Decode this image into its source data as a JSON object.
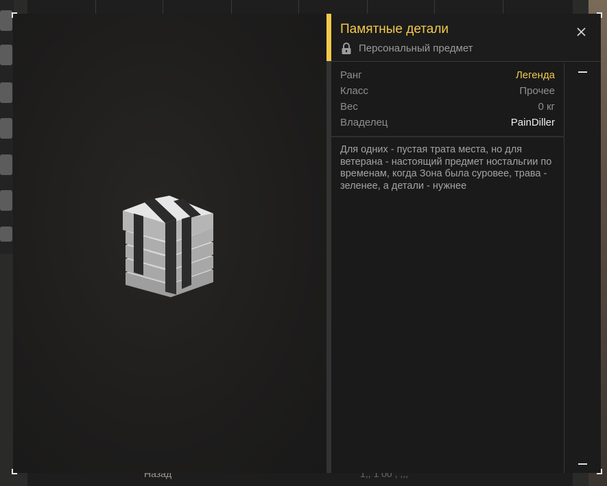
{
  "background": {
    "bottom_left_button": "Назад",
    "bottom_center_text": "1,, 1 00 , ,,,",
    "accent_color": "#f2c94c"
  },
  "modal": {
    "title": "Памятные детали",
    "subtitle": "Персональный предмет",
    "stats": [
      {
        "label": "Ранг",
        "value": "Легенда"
      },
      {
        "label": "Класс",
        "value": "Прочее"
      },
      {
        "label": "Вес",
        "value": "0 кг"
      },
      {
        "label": "Владелец",
        "value": "PainDiller"
      }
    ],
    "description": "Для одних - пустая трата места, но для ветерана - настоящий предмет ностальгии по временам, когда Зона была суровее, трава - зеленее, а детали - нужнее",
    "icons": {
      "lock": "lock-icon",
      "close": "close-icon",
      "item": "memorable-parts-item-image"
    }
  }
}
